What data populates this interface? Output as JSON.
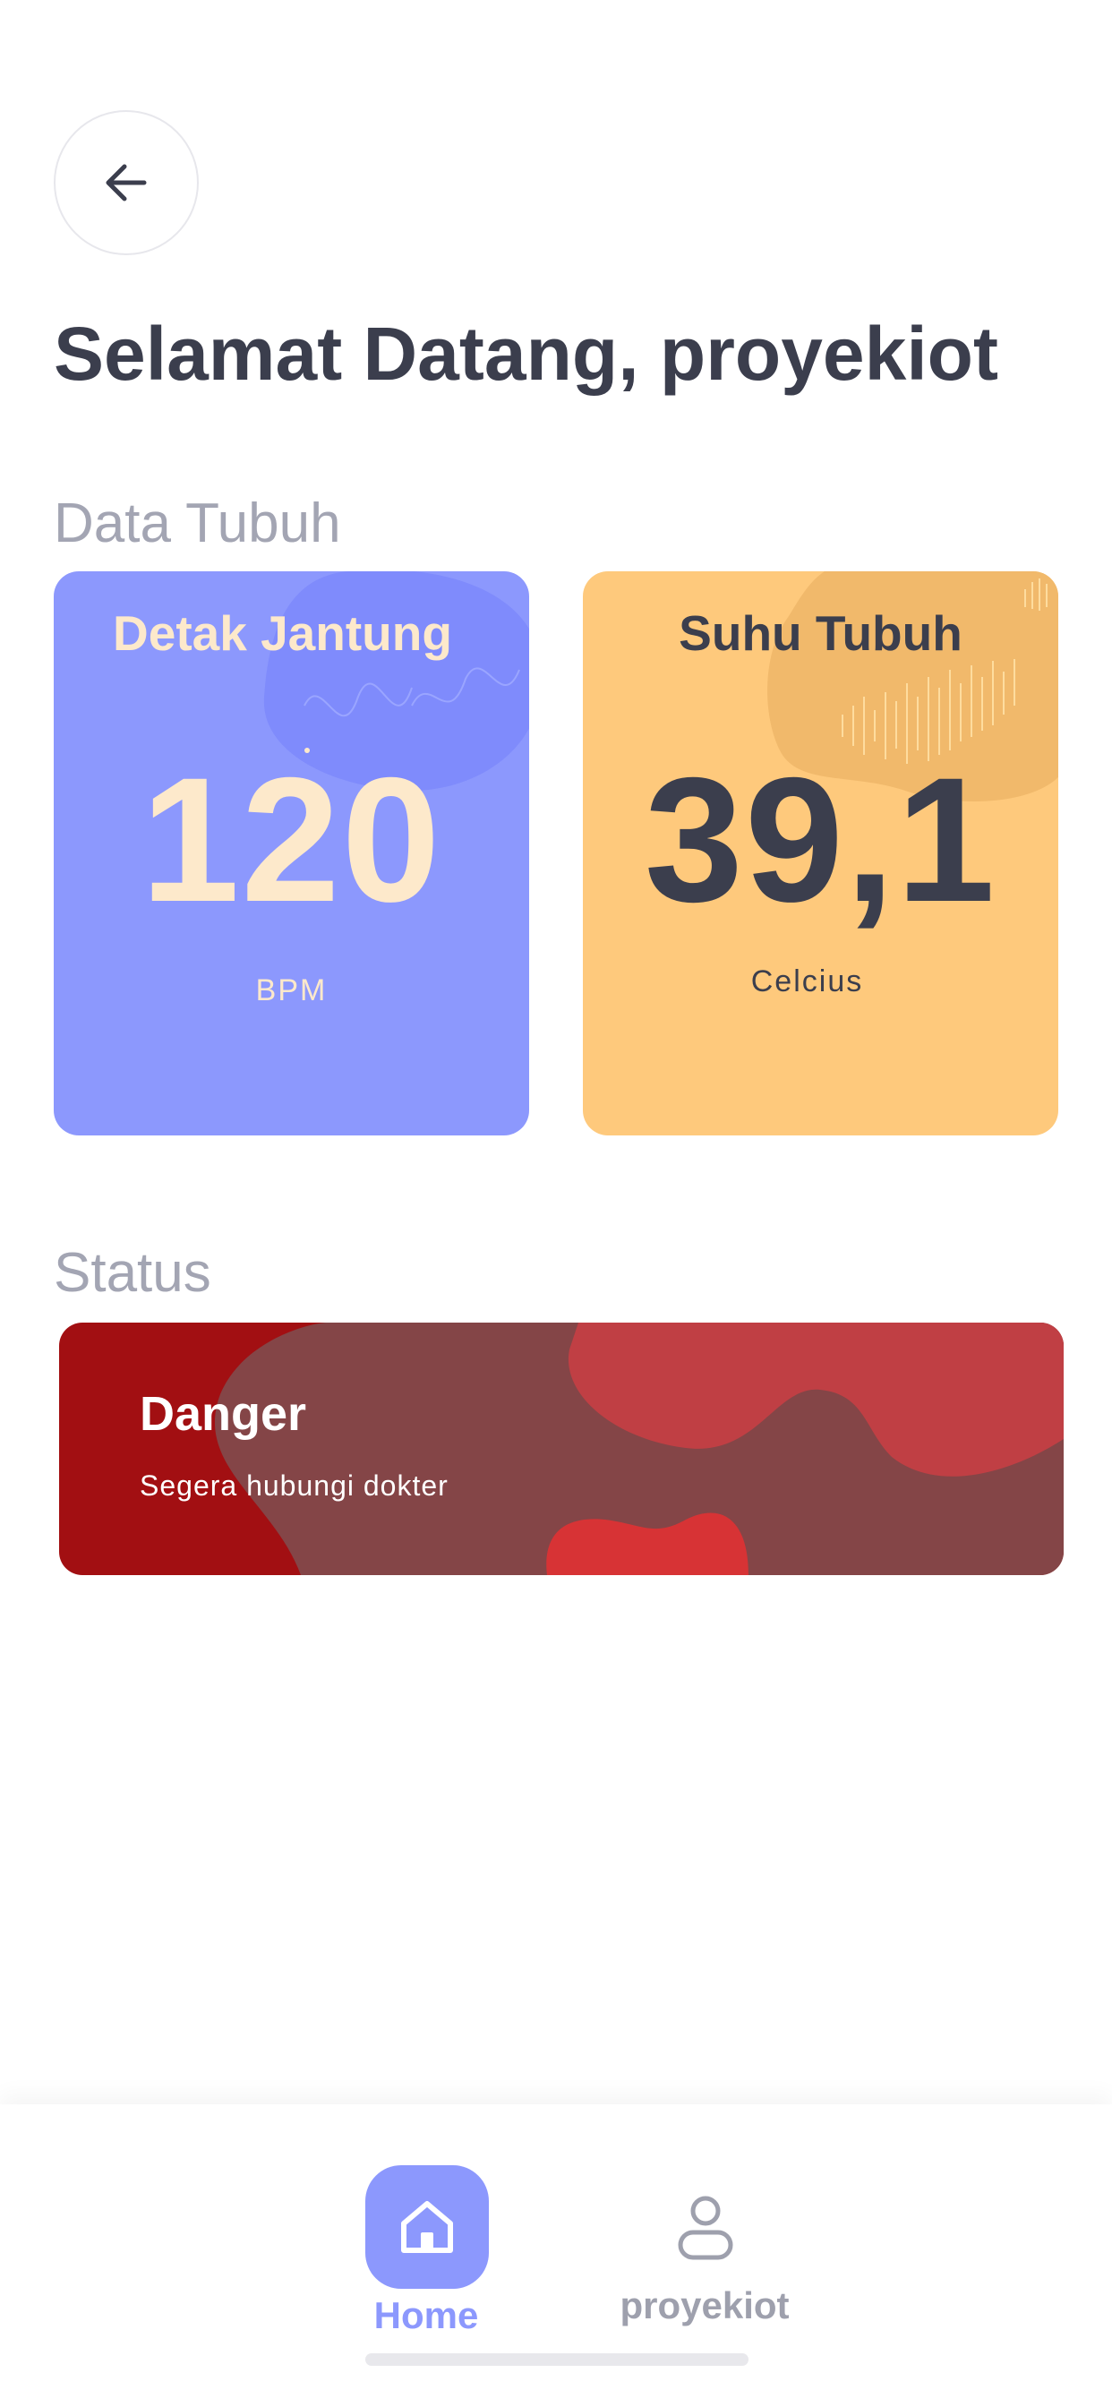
{
  "header": {
    "back_icon": "arrow-left-icon",
    "title": "Selamat Datang, proyekiot"
  },
  "sections": {
    "data_tubuh": "Data Tubuh",
    "status": "Status"
  },
  "cards": {
    "heart": {
      "title": "Detak Jantung",
      "value": "120",
      "unit": "BPM",
      "color": "#8c98fd"
    },
    "temperature": {
      "title": "Suhu Tubuh",
      "value": "39,1",
      "unit": "Celcius",
      "color": "#fec97c"
    }
  },
  "status": {
    "title": "Danger",
    "message": "Segera hubungi dokter",
    "color": "#a20f12"
  },
  "bottom_nav": {
    "items": [
      {
        "label": "Home",
        "icon": "home-icon",
        "active": true
      },
      {
        "label": "proyekiot",
        "icon": "user-icon",
        "active": false
      }
    ],
    "active_color": "#8c98fd",
    "inactive_color": "#9ea0ad"
  }
}
